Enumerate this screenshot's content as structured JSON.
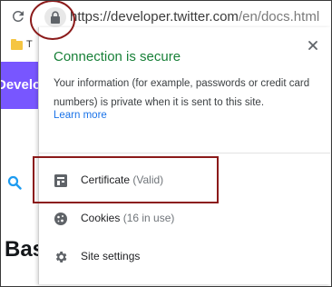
{
  "browser": {
    "url_main": "https://developer.twitter.com",
    "url_path": "/en/docs.html",
    "bookmark_folder_label": "T"
  },
  "page": {
    "header_text": "Developer",
    "heading_text": "Bas"
  },
  "popup": {
    "title": "Connection is secure",
    "description": "Your information (for example, passwords or credit card numbers) is private when it is sent to this site.",
    "learn_more": "Learn more",
    "items": [
      {
        "label": "Certificate",
        "sub": "(Valid)",
        "icon": "certificate-icon"
      },
      {
        "label": "Cookies",
        "sub": "(16 in use)",
        "icon": "cookie-icon"
      },
      {
        "label": "Site settings",
        "sub": "",
        "icon": "gear-icon"
      }
    ]
  },
  "colors": {
    "secure_green": "#188038",
    "link_blue": "#1a73e8",
    "annotation_red": "#8b1a1a",
    "twitter_purple": "#7856ff"
  }
}
